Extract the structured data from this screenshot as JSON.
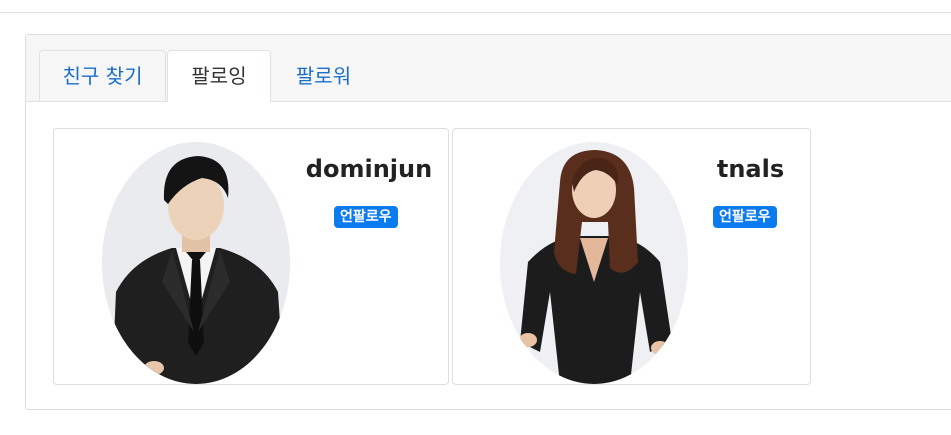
{
  "tabs": [
    {
      "label": "친구 찾기"
    },
    {
      "label": "팔로잉",
      "active": true
    },
    {
      "label": "팔로워"
    }
  ],
  "following": [
    {
      "username": "dominjun",
      "action_label": "언팔로우"
    },
    {
      "username": "tnals",
      "action_label": "언팔로우"
    }
  ],
  "colors": {
    "link": "#1a6fc9",
    "badge": "#0d7bf0"
  }
}
